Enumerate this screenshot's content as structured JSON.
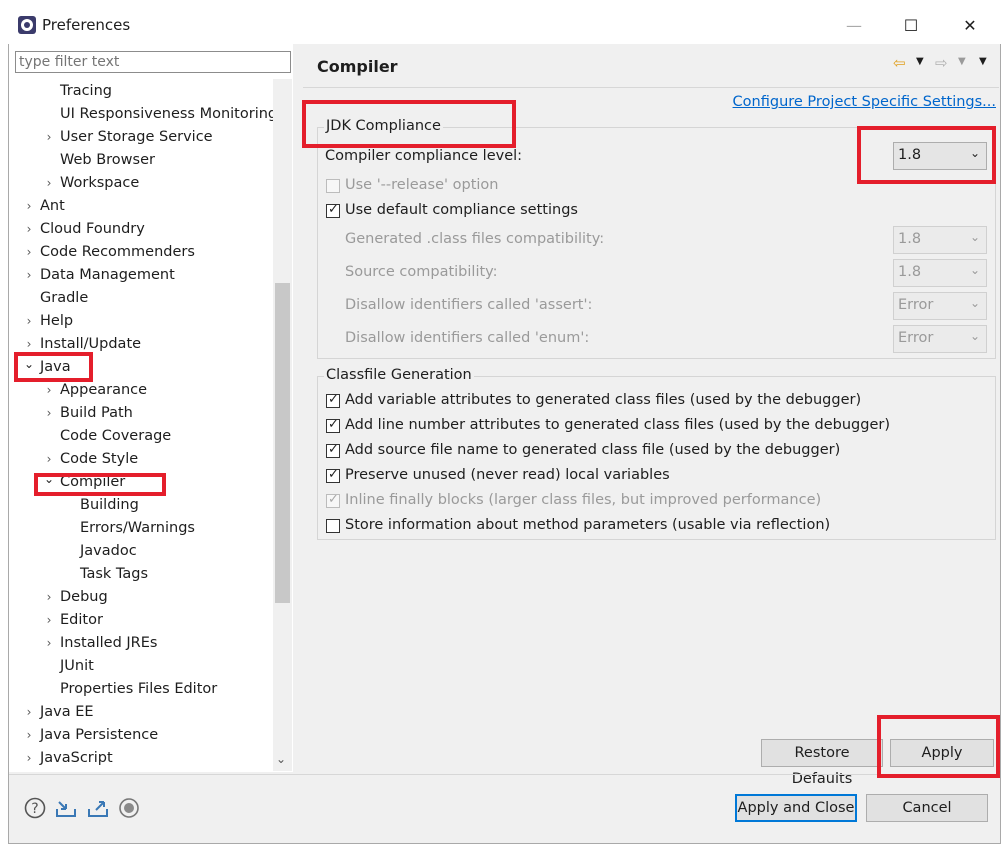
{
  "window": {
    "title": "Preferences",
    "minimize": "—",
    "maximize": "☐",
    "close": "✕"
  },
  "filter": {
    "placeholder": "type filter text"
  },
  "tree": [
    {
      "label": "Tracing",
      "chevron": ""
    },
    {
      "label": "UI Responsiveness Monitoring",
      "chevron": ""
    },
    {
      "label": "User Storage Service",
      "chevron": "›"
    },
    {
      "label": "Web Browser",
      "chevron": ""
    },
    {
      "label": "Workspace",
      "chevron": "›"
    },
    {
      "label": "Ant",
      "chevron": "›"
    },
    {
      "label": "Cloud Foundry",
      "chevron": "›"
    },
    {
      "label": "Code Recommenders",
      "chevron": "›"
    },
    {
      "label": "Data Management",
      "chevron": "›"
    },
    {
      "label": "Gradle",
      "chevron": ""
    },
    {
      "label": "Help",
      "chevron": "›"
    },
    {
      "label": "Install/Update",
      "chevron": "›"
    },
    {
      "label": "Java",
      "chevron": "⌄"
    },
    {
      "label": "Appearance",
      "chevron": "›"
    },
    {
      "label": "Build Path",
      "chevron": "›"
    },
    {
      "label": "Code Coverage",
      "chevron": ""
    },
    {
      "label": "Code Style",
      "chevron": "›"
    },
    {
      "label": "Compiler",
      "chevron": "⌄"
    },
    {
      "label": "Building",
      "chevron": ""
    },
    {
      "label": "Errors/Warnings",
      "chevron": ""
    },
    {
      "label": "Javadoc",
      "chevron": ""
    },
    {
      "label": "Task Tags",
      "chevron": ""
    },
    {
      "label": "Debug",
      "chevron": "›"
    },
    {
      "label": "Editor",
      "chevron": "›"
    },
    {
      "label": "Installed JREs",
      "chevron": "›"
    },
    {
      "label": "JUnit",
      "chevron": ""
    },
    {
      "label": "Properties Files Editor",
      "chevron": ""
    },
    {
      "label": "Java EE",
      "chevron": "›"
    },
    {
      "label": "Java Persistence",
      "chevron": "›"
    },
    {
      "label": "JavaScript",
      "chevron": "›"
    }
  ],
  "page": {
    "title": "Compiler",
    "configure_link": "Configure Project Specific Settings...",
    "jdk": {
      "group_title": "JDK Compliance",
      "level_label": "Compiler compliance level:",
      "level_value": "1.8",
      "release_label": "Use '--release' option",
      "default_label": "Use default compliance settings",
      "generated_label": "Generated .class files compatibility:",
      "generated_value": "1.8",
      "source_label": "Source compatibility:",
      "source_value": "1.8",
      "assert_label": "Disallow identifiers called 'assert':",
      "assert_value": "Error",
      "enum_label": "Disallow identifiers called 'enum':",
      "enum_value": "Error"
    },
    "classfile": {
      "group_title": "Classfile Generation",
      "items": [
        {
          "label": "Add variable attributes to generated class files (used by the debugger)",
          "checked": true,
          "disabled": false
        },
        {
          "label": "Add line number attributes to generated class files (used by the debugger)",
          "checked": true,
          "disabled": false
        },
        {
          "label": "Add source file name to generated class file (used by the debugger)",
          "checked": true,
          "disabled": false
        },
        {
          "label": "Preserve unused (never read) local variables",
          "checked": true,
          "disabled": false
        },
        {
          "label": "Inline finally blocks (larger class files, but improved performance)",
          "checked": true,
          "disabled": true
        },
        {
          "label": "Store information about method parameters (usable via reflection)",
          "checked": false,
          "disabled": false
        }
      ]
    },
    "restore_defaults": "Restore Defaults",
    "apply": "Apply"
  },
  "footer": {
    "apply_close": "Apply and Close",
    "cancel": "Cancel"
  },
  "colors": {
    "highlight": "#e41e2b",
    "link": "#0066cc",
    "accent": "#0078d7"
  }
}
